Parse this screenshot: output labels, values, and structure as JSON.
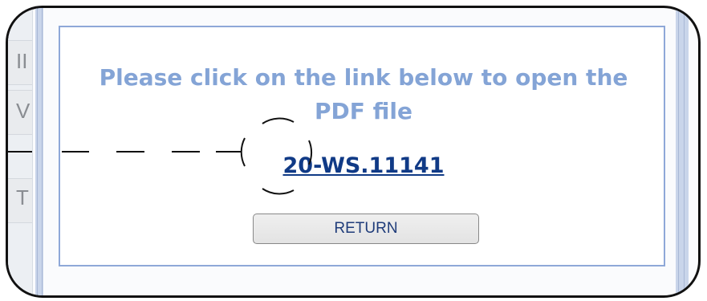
{
  "dialog": {
    "message": "Please click on the link below to open the PDF file",
    "link_text": "20-WS.11141",
    "return_label": "RETURN"
  },
  "background": {
    "letters": [
      "II",
      "V",
      "T"
    ]
  },
  "colors": {
    "message": "#84a4d6",
    "link": "#103a86",
    "dialog_border": "#8ea8d8",
    "frame": "#111111"
  }
}
